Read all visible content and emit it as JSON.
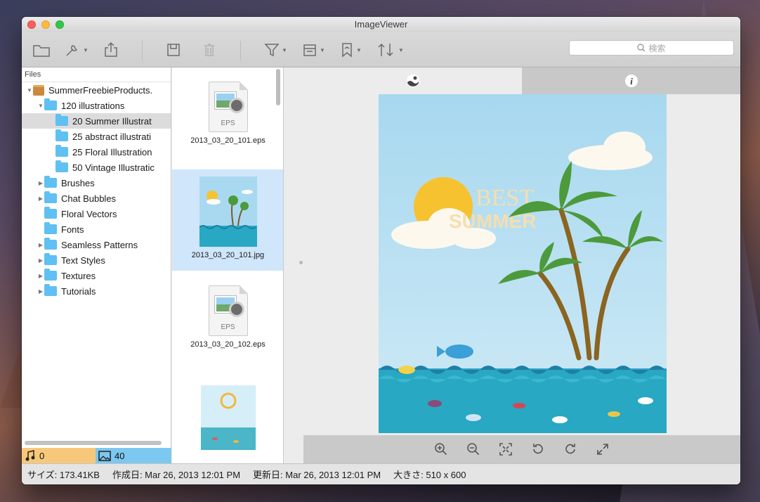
{
  "window": {
    "title": "ImageViewer"
  },
  "toolbar": {
    "search_placeholder": "検索",
    "buttons": [
      "folder-icon",
      "tools-icon",
      "share-icon",
      "save-icon",
      "trash-icon",
      "filter-icon",
      "calendar-icon",
      "bookmark-icon",
      "sort-icon"
    ]
  },
  "files": {
    "header": "Files",
    "root": "SummerFreebieProducts.",
    "tree": [
      {
        "label": "120 illustrations",
        "level": 1,
        "expanded": true
      },
      {
        "label": "20 Summer Illustrat",
        "level": 2,
        "selected": true
      },
      {
        "label": "25 abstract illustrati",
        "level": 2
      },
      {
        "label": "25 Floral Illustration",
        "level": 2
      },
      {
        "label": "50 Vintage Illustratic",
        "level": 2
      },
      {
        "label": "Brushes",
        "level": 1,
        "collapsed": true
      },
      {
        "label": "Chat Bubbles",
        "level": 1,
        "collapsed": true
      },
      {
        "label": "Floral Vectors",
        "level": 1
      },
      {
        "label": "Fonts",
        "level": 1
      },
      {
        "label": "Seamless Patterns",
        "level": 1,
        "collapsed": true
      },
      {
        "label": "Text Styles",
        "level": 1,
        "collapsed": true
      },
      {
        "label": "Textures",
        "level": 1,
        "collapsed": true
      },
      {
        "label": "Tutorials",
        "level": 1,
        "collapsed": true
      }
    ],
    "audio_count": "0",
    "image_count": "40"
  },
  "thumbnails": [
    {
      "name": "2013_03_20_101.eps",
      "kind": "EPS"
    },
    {
      "name": "2013_03_20_101.jpg",
      "kind": "JPG",
      "selected": true
    },
    {
      "name": "2013_03_20_102.eps",
      "kind": "EPS"
    }
  ],
  "preview": {
    "headline_1": "BEST",
    "headline_2": "SUMMER",
    "colors": {
      "sky": "#a9d9f0",
      "sun": "#f7c230",
      "sea": "#28a8c2",
      "palm": "#4c9a3c"
    }
  },
  "status": {
    "size": "サイズ: 173.41KB",
    "created": "作成日: Mar 26, 2013 12:01 PM",
    "modified": "更新日: Mar 26, 2013 12:01 PM",
    "dimensions": "大きさ: 510 x 600"
  }
}
